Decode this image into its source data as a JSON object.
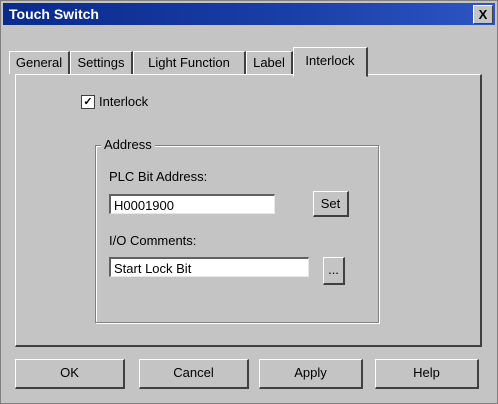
{
  "window": {
    "title": "Touch Switch",
    "close_glyph": "X"
  },
  "tabs": [
    {
      "label": "General"
    },
    {
      "label": "Settings"
    },
    {
      "label": "Light Function"
    },
    {
      "label": "Label"
    },
    {
      "label": "Interlock",
      "active": true
    }
  ],
  "interlock": {
    "checkbox_label": "Interlock",
    "checked": true,
    "check_glyph": "✓"
  },
  "address": {
    "group_label": "Address",
    "plc_bit_label": "PLC Bit Address:",
    "plc_bit_value": "H0001900",
    "set_button": "Set",
    "io_comments_label": "I/O Comments:",
    "io_comments_value": "Start Lock Bit",
    "browse_button": "..."
  },
  "buttons": {
    "ok": "OK",
    "cancel": "Cancel",
    "apply": "Apply",
    "help": "Help"
  }
}
